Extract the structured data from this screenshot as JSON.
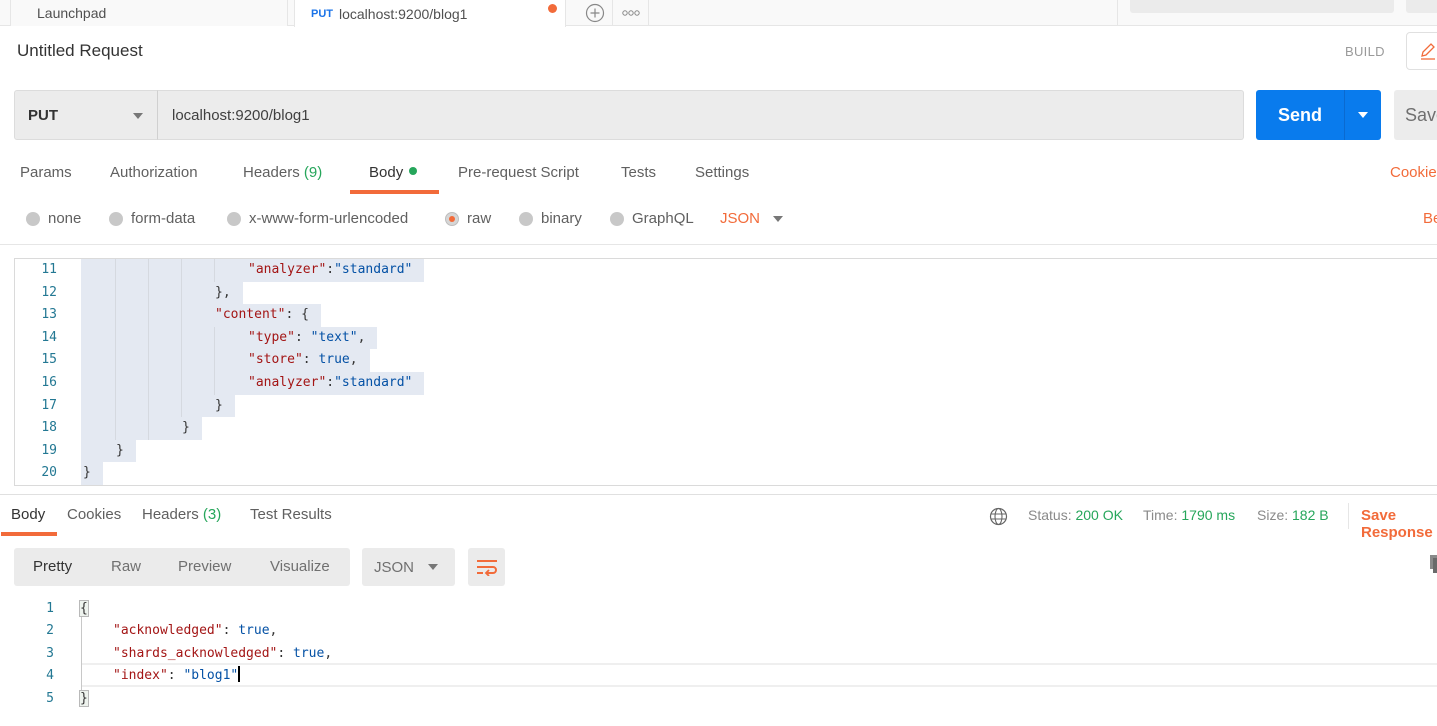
{
  "tabs": {
    "launchpad_label": "Launchpad",
    "active": {
      "method": "PUT",
      "label": "localhost:9200/blog1",
      "unsaved": true
    },
    "add_icon": "plus-circle-icon",
    "more_icon": "more-horizontal-icon"
  },
  "request": {
    "title": "Untitled Request",
    "build_label": "BUILD",
    "method": "PUT",
    "url": "localhost:9200/blog1",
    "send_label": "Send",
    "save_label": "Save",
    "tabs": [
      {
        "label": "Params"
      },
      {
        "label": "Authorization"
      },
      {
        "label": "Headers",
        "count": "(9)"
      },
      {
        "label": "Body",
        "active": true,
        "has_content": true
      },
      {
        "label": "Pre-request Script"
      },
      {
        "label": "Tests"
      },
      {
        "label": "Settings"
      }
    ],
    "cookies_link": "Cookies",
    "body_types": [
      {
        "label": "none"
      },
      {
        "label": "form-data"
      },
      {
        "label": "x-www-form-urlencoded"
      },
      {
        "label": "raw",
        "selected": true
      },
      {
        "label": "binary"
      },
      {
        "label": "GraphQL"
      }
    ],
    "raw_format": "JSON",
    "beautify_link": "Beautify",
    "body_lines": [
      {
        "n": "11",
        "key": "\"analyzer\"",
        "sep": ":",
        "value": "\"standard\"",
        "tail": ""
      },
      {
        "n": "12",
        "text": "},"
      },
      {
        "n": "13",
        "key": "\"content\"",
        "sep": ": ",
        "value": "",
        "tail": "{"
      },
      {
        "n": "14",
        "key": "\"type\"",
        "sep": ": ",
        "value": "\"text\"",
        "tail": ","
      },
      {
        "n": "15",
        "key": "\"store\"",
        "sep": ": ",
        "value": "true",
        "tail": ","
      },
      {
        "n": "16",
        "key": "\"analyzer\"",
        "sep": ":",
        "value": "\"standard\"",
        "tail": ""
      },
      {
        "n": "17",
        "text": "}"
      },
      {
        "n": "18",
        "text": "}"
      },
      {
        "n": "19",
        "text": "}"
      },
      {
        "n": "20",
        "text": "}"
      }
    ]
  },
  "response": {
    "tabs": [
      {
        "label": "Body",
        "active": true
      },
      {
        "label": "Cookies"
      },
      {
        "label": "Headers",
        "count": "(3)"
      },
      {
        "label": "Test Results"
      }
    ],
    "status_label": "Status:",
    "status_value": "200 OK",
    "time_label": "Time:",
    "time_value": "1790 ms",
    "size_label": "Size:",
    "size_value": "182 B",
    "save_response_label": "Save Response",
    "view_modes": [
      {
        "label": "Pretty",
        "active": true
      },
      {
        "label": "Raw"
      },
      {
        "label": "Preview"
      },
      {
        "label": "Visualize"
      }
    ],
    "format": "JSON",
    "body_lines": [
      {
        "n": "1",
        "text": "{"
      },
      {
        "n": "2",
        "key": "\"acknowledged\"",
        "sep": ": ",
        "value": "true",
        "tail": ","
      },
      {
        "n": "3",
        "key": "\"shards_acknowledged\"",
        "sep": ": ",
        "value": "true",
        "tail": ","
      },
      {
        "n": "4",
        "key": "\"index\"",
        "sep": ": ",
        "value": "\"blog1\"",
        "tail": ""
      },
      {
        "n": "5",
        "text": "}"
      }
    ]
  },
  "colors": {
    "accent": "#f26b3a",
    "primary": "#097bed",
    "success": "#26a65b"
  }
}
